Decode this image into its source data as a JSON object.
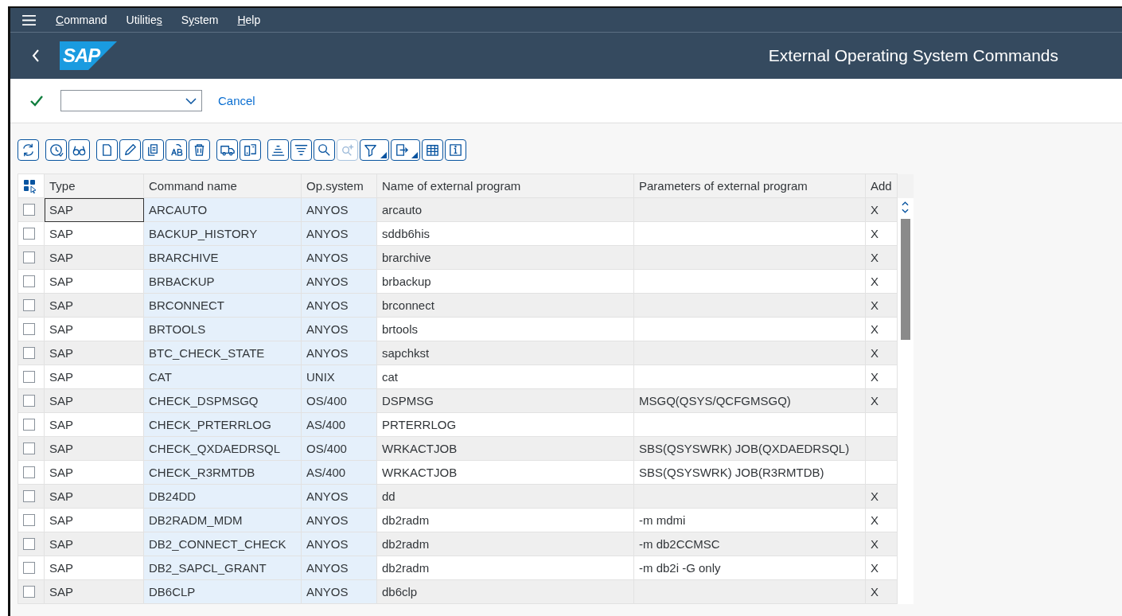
{
  "menu_bar": {
    "items": [
      {
        "key": "C",
        "post": "ommand"
      },
      {
        "pre": "Utilitie",
        "key": "s"
      },
      {
        "pre": "S",
        "key": "y",
        "post": "stem"
      },
      {
        "key": "H",
        "post": "elp"
      }
    ]
  },
  "header": {
    "logo": "SAP",
    "title": "External Operating System Commands"
  },
  "command_bar": {
    "cancel": "Cancel"
  },
  "toolbar": [
    {
      "kind": "refresh"
    },
    {
      "kind": "clock"
    },
    {
      "kind": "glasses"
    },
    {
      "kind": "page"
    },
    {
      "kind": "pencil"
    },
    {
      "kind": "copy"
    },
    {
      "kind": "ab"
    },
    {
      "kind": "trash"
    },
    {
      "kind": "truck"
    },
    {
      "kind": "swap"
    },
    {
      "kind": "sort-asc"
    },
    {
      "kind": "sort-desc"
    },
    {
      "kind": "search"
    },
    {
      "kind": "search-next",
      "disabled": true
    },
    {
      "kind": "filter",
      "dropdown": true
    },
    {
      "kind": "export",
      "dropdown": true
    },
    {
      "kind": "grid"
    },
    {
      "kind": "info"
    }
  ],
  "table": {
    "columns": [
      "Type",
      "Command name",
      "Op.system",
      "Name of external program",
      "Parameters of external program",
      "Add"
    ],
    "rows": [
      {
        "selected": false,
        "type": "SAP",
        "command": "ARCAUTO",
        "os": "ANYOS",
        "program": "arcauto",
        "add": "X"
      },
      {
        "selected": false,
        "type": "SAP",
        "command": "BACKUP_HISTORY",
        "os": "ANYOS",
        "program": "sddb6his",
        "add": "X"
      },
      {
        "selected": false,
        "type": "SAP",
        "command": "BRARCHIVE",
        "os": "ANYOS",
        "program": "brarchive",
        "add": "X"
      },
      {
        "selected": false,
        "type": "SAP",
        "command": "BRBACKUP",
        "os": "ANYOS",
        "program": "brbackup",
        "add": "X"
      },
      {
        "selected": false,
        "type": "SAP",
        "command": "BRCONNECT",
        "os": "ANYOS",
        "program": "brconnect",
        "add": "X"
      },
      {
        "selected": false,
        "type": "SAP",
        "command": "BRTOOLS",
        "os": "ANYOS",
        "program": "brtools",
        "add": "X"
      },
      {
        "selected": false,
        "type": "SAP",
        "command": "BTC_CHECK_STATE",
        "os": "ANYOS",
        "program": "sapchkst",
        "add": "X"
      },
      {
        "selected": false,
        "type": "SAP",
        "command": "CAT",
        "os": "UNIX",
        "program": "cat",
        "add": "X"
      },
      {
        "selected": false,
        "type": "SAP",
        "command": "CHECK_DSPMSGQ",
        "os": "OS/400",
        "program": "DSPMSG",
        "params": "MSGQ(QSYS/QCFGMSGQ)",
        "add": "X"
      },
      {
        "selected": false,
        "type": "SAP",
        "command": "CHECK_PRTERRLOG",
        "os": "AS/400",
        "program": "PRTERRLOG"
      },
      {
        "selected": false,
        "type": "SAP",
        "command": "CHECK_QXDAEDRSQL",
        "os": "OS/400",
        "program": "WRKACTJOB",
        "params": "SBS(QSYSWRK) JOB(QXDAEDRSQL)"
      },
      {
        "selected": false,
        "type": "SAP",
        "command": "CHECK_R3RMTDB",
        "os": "AS/400",
        "program": "WRKACTJOB",
        "params": "SBS(QSYSWRK) JOB(R3RMTDB)"
      },
      {
        "selected": false,
        "type": "SAP",
        "command": "DB24DD",
        "os": "ANYOS",
        "program": "dd",
        "add": "X"
      },
      {
        "selected": false,
        "type": "SAP",
        "command": "DB2RADM_MDM",
        "os": "ANYOS",
        "program": "db2radm",
        "params": "-m mdmi",
        "add": "X"
      },
      {
        "selected": false,
        "type": "SAP",
        "command": "DB2_CONNECT_CHECK",
        "os": "ANYOS",
        "program": "db2radm",
        "params": "-m db2CCMSC",
        "add": "X"
      },
      {
        "selected": false,
        "type": "SAP",
        "command": "DB2_SAPCL_GRANT",
        "os": "ANYOS",
        "program": "db2radm",
        "params": "-m db2i -G only",
        "add": "X"
      },
      {
        "selected": false,
        "type": "SAP",
        "command": "DB6CLP",
        "os": "ANYOS",
        "program": "db6clp",
        "add": "X"
      }
    ]
  }
}
